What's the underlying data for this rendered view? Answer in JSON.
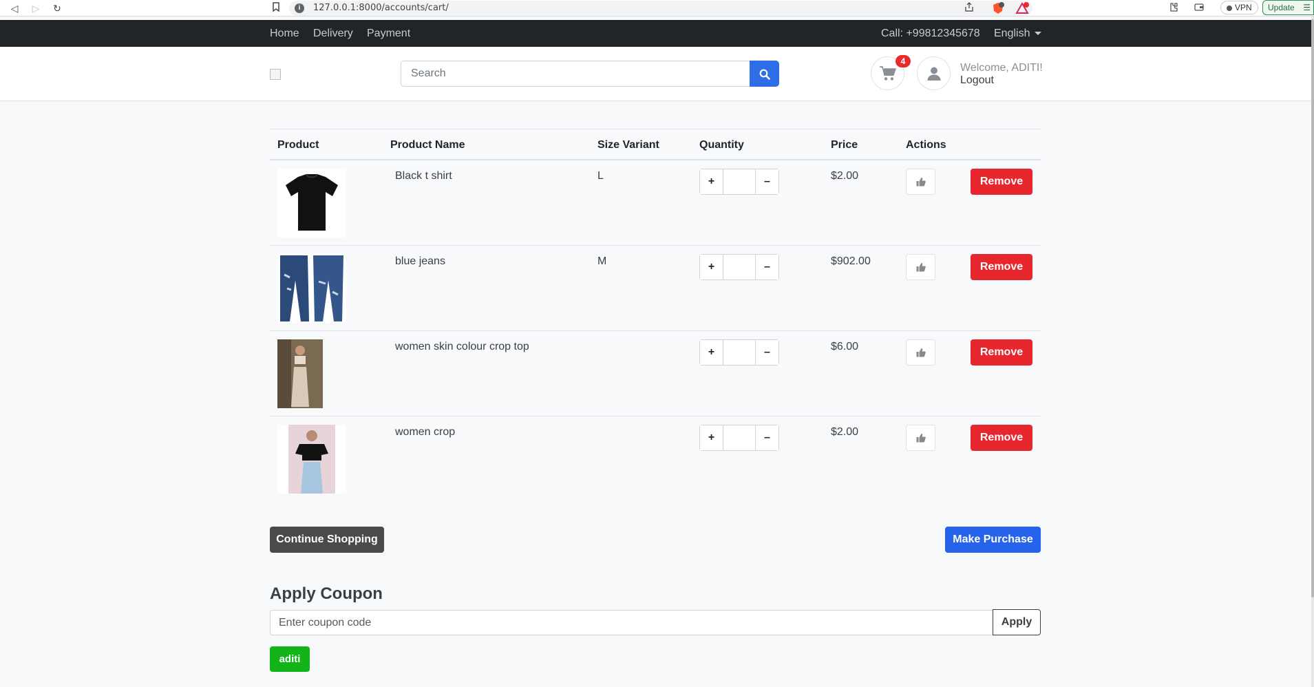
{
  "browser": {
    "url": "127.0.0.1:8000/accounts/cart/",
    "vpn_label": "VPN",
    "update_label": "Update",
    "brave_badge": "1",
    "alert_badge": "5"
  },
  "topnav": {
    "links": [
      "Home",
      "Delivery",
      "Payment"
    ],
    "call": "Call: +99812345678",
    "language": "English"
  },
  "header": {
    "search_placeholder": "Search",
    "cart_count": "4",
    "welcome": "Welcome, ADITI!",
    "logout": "Logout"
  },
  "table": {
    "headers": [
      "Product",
      "Product Name",
      "Size Variant",
      "Quantity",
      "Price",
      "Actions"
    ],
    "rows": [
      {
        "name": "Black t shirt",
        "size": "L",
        "price": "$2.00",
        "image": "black-tshirt-image"
      },
      {
        "name": "blue jeans",
        "size": "M",
        "price": "$902.00",
        "image": "blue-jeans-image"
      },
      {
        "name": "women skin colour crop top",
        "size": "",
        "price": "$6.00",
        "image": "crop-top-image"
      },
      {
        "name": "women crop",
        "size": "",
        "price": "$2.00",
        "image": "women-crop-image"
      }
    ],
    "plus": "+",
    "minus": "–",
    "remove": "Remove"
  },
  "actions": {
    "continue": "Continue Shopping",
    "purchase": "Make Purchase"
  },
  "coupon": {
    "title": "Apply Coupon",
    "placeholder": "Enter coupon code",
    "apply": "Apply",
    "applied_code": "aditi"
  },
  "colors": {
    "primary": "#2563eb",
    "danger": "#e8262d",
    "success": "#12b41a",
    "dark": "#212529"
  }
}
